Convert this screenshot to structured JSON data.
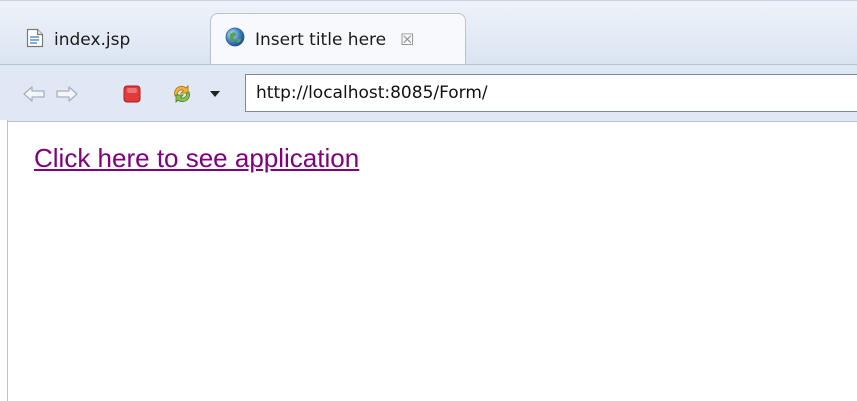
{
  "tabs": [
    {
      "label": "index.jsp",
      "icon": "jsp-file-icon",
      "active": false
    },
    {
      "label": "Insert title here",
      "icon": "globe-icon",
      "active": true,
      "close_glyph": "☒"
    }
  ],
  "toolbar": {
    "url": "http://localhost:8085/Form/"
  },
  "content": {
    "link_text": "Click here to see application",
    "link_color": "#800080"
  }
}
